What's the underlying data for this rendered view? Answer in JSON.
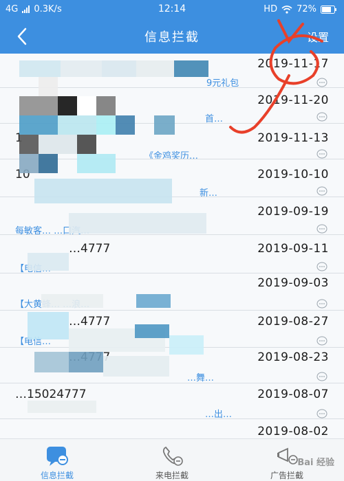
{
  "status_bar": {
    "network": "4G",
    "speed": "0.3K/s",
    "time": "12:14",
    "hd": "HD",
    "battery": "72%"
  },
  "nav": {
    "title": "信息拦截",
    "settings_label": "设置"
  },
  "rows": [
    {
      "date": "2019-11-17",
      "number": "",
      "preview": "9元礼包"
    },
    {
      "date": "2019-11-20",
      "number": "",
      "preview": "首…"
    },
    {
      "date": "2019-11-13",
      "number": "1",
      "preview": "《金鸡奖历…"
    },
    {
      "date": "2019-10-10",
      "number": "10",
      "preview": "新…"
    },
    {
      "date": "2019-09-19",
      "number": "",
      "preview": "每敏客…  …口汽…"
    },
    {
      "date": "2019-09-11",
      "number": "…4777",
      "preview": "【电信…"
    },
    {
      "date": "2019-09-03",
      "number": "",
      "preview": "【大黄蜂…  …浪…"
    },
    {
      "date": "2019-08-27",
      "number": "…4777",
      "preview": "【电信…"
    },
    {
      "date": "2019-08-23",
      "number": "…4777",
      "preview": "…舞…"
    },
    {
      "date": "2019-08-07",
      "number": "…15024777",
      "preview": "…出…"
    },
    {
      "date": "2019-08-02",
      "number": "",
      "preview": ""
    }
  ],
  "tabs": [
    {
      "label": "信息拦截",
      "icon": "message-block-icon"
    },
    {
      "label": "来电拦截",
      "icon": "phone-block-icon"
    },
    {
      "label": "广告拦截",
      "icon": "ad-block-icon"
    }
  ],
  "watermark": "Bai 经验",
  "colors": {
    "primary": "#3d8fe0",
    "annotation": "#e8402a"
  }
}
